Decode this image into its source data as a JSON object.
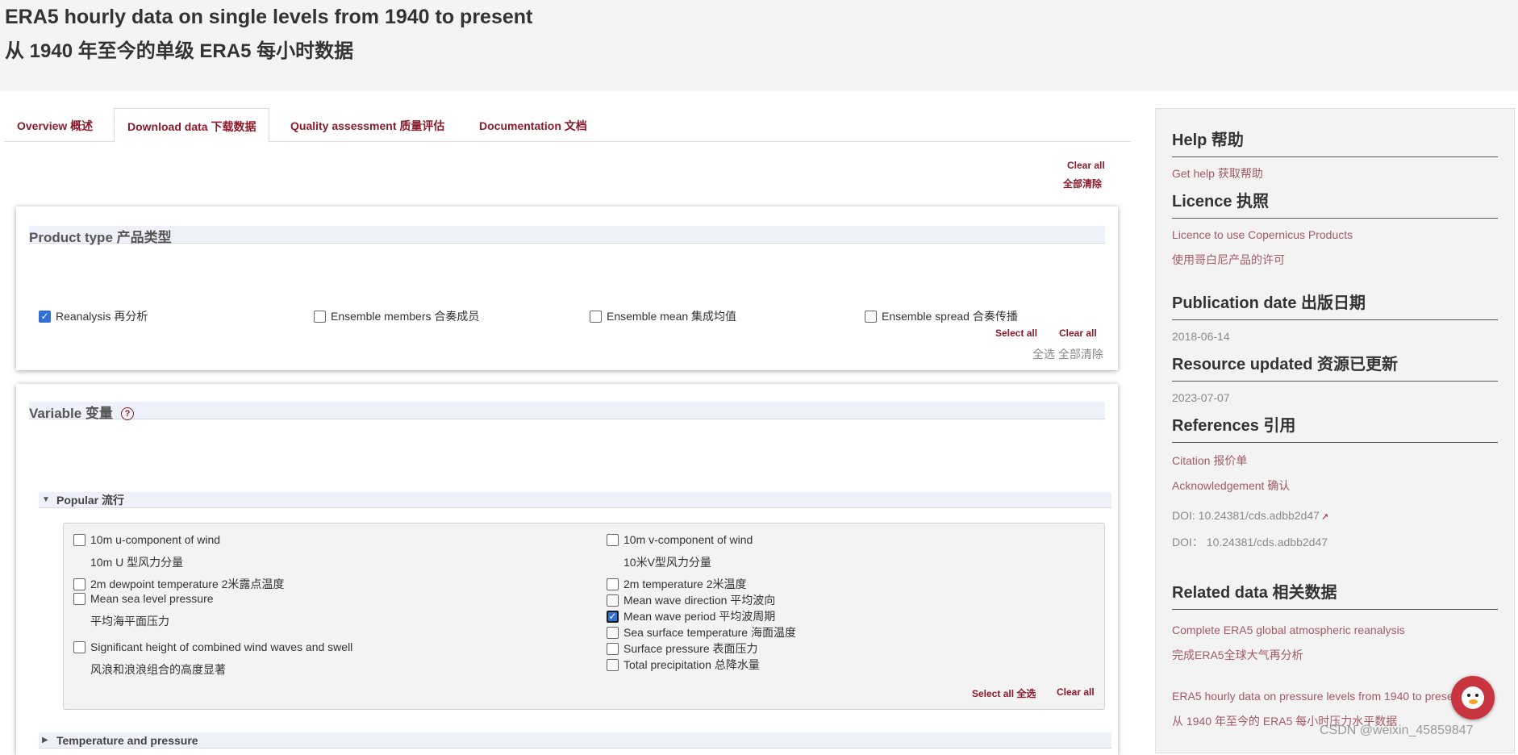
{
  "header": {
    "title_en": "ERA5 hourly data on single levels from 1940 to present",
    "title_zh": "从 1940 年至今的单级 ERA5 每小时数据"
  },
  "tabs": [
    {
      "label": "Overview  概述"
    },
    {
      "label": "Download data  下载数据"
    },
    {
      "label": "Quality assessment  质量评估"
    },
    {
      "label": "Documentation  文档"
    }
  ],
  "top_clear": {
    "en": "Clear all",
    "zh": "全部清除"
  },
  "product_type": {
    "title": "Product type 产品类型",
    "options": [
      {
        "label": "Reanalysis 再分析",
        "checked": true
      },
      {
        "label": "Ensemble members 合奏成员",
        "checked": false
      },
      {
        "label": "Ensemble mean 集成均值",
        "checked": false
      },
      {
        "label": "Ensemble spread 合奏传播",
        "checked": false
      }
    ],
    "select_all": "Select all",
    "clear_all": "Clear all",
    "zh_links": "全选 全部清除"
  },
  "variable": {
    "title": "Variable 变量",
    "help_glyph": "?",
    "popular_label": "Popular  流行",
    "left": [
      {
        "label": "10m u-component of wind",
        "sub": "10m U 型风力分量"
      },
      {
        "label": "2m dewpoint temperature  2米露点温度",
        "sub": ""
      },
      {
        "label": "Mean sea level pressure",
        "sub": "平均海平面压力"
      },
      {
        "label": "Significant height of combined wind waves and swell",
        "sub": "风浪和浪浪组合的高度显著"
      }
    ],
    "right": [
      {
        "label": "10m v-component of wind",
        "sub": "10米V型风力分量",
        "checked": false
      },
      {
        "label": "2m temperature  2米温度",
        "checked": false
      },
      {
        "label": "Mean wave direction  平均波向",
        "checked": false
      },
      {
        "label": "Mean wave period  平均波周期",
        "checked": true
      },
      {
        "label": "Sea surface temperature  海面温度",
        "checked": false
      },
      {
        "label": "Surface pressure  表面压力",
        "checked": false
      },
      {
        "label": "Total precipitation  总降水量",
        "checked": false
      }
    ],
    "select_all": "Select all 全选",
    "clear_all": "Clear all",
    "next_section": "Temperature and pressure"
  },
  "sidebar": {
    "help_heading": "Help 帮助",
    "help_link": "Get help 获取帮助",
    "licence_heading": "Licence 执照",
    "licence_link_en": "Licence to use Copernicus Products",
    "licence_link_zh": "使用哥白尼产品的许可",
    "pub_heading": "Publication date 出版日期",
    "pub_date": "2018-06-14",
    "updated_heading": "Resource updated 资源已更新",
    "updated_date": "2023-07-07",
    "refs_heading": "References 引用",
    "citation": "Citation 报价单",
    "ack": "Acknowledgement 确认",
    "doi_en": "DOI: 10.24381/cds.adbb2d47",
    "doi_zh": "DOI：  10.24381/cds.adbb2d47",
    "related_heading": "Related data 相关数据",
    "rel1_en": "Complete ERA5 global atmospheric reanalysis",
    "rel1_zh": "完成ERA5全球大气再分析",
    "rel2_en": "ERA5 hourly data on pressure levels from 1940 to prese",
    "rel2_zh": "从 1940 年至今的 ERA5 每小时压力水平数据"
  },
  "watermark": "CSDN @weixin_45859847",
  "colors": {
    "accent": "#8b1a2b",
    "link": "#a35a66",
    "checkbox": "#2f6fd6"
  }
}
